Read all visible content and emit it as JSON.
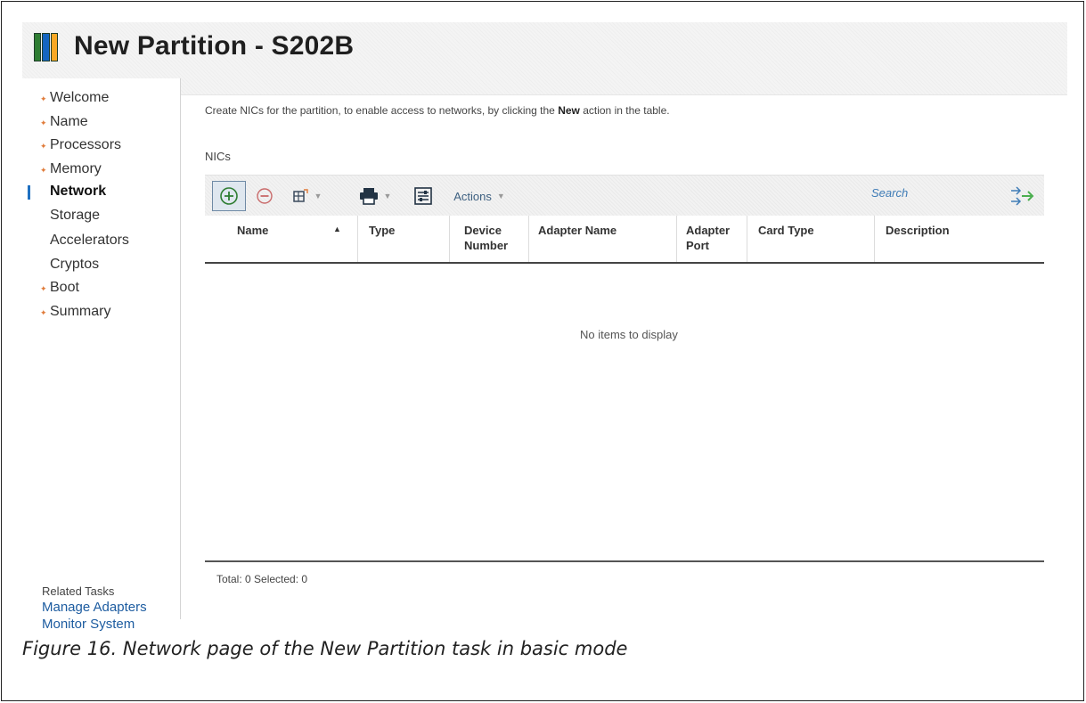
{
  "window": {
    "title": "New Partition - S202B"
  },
  "sidebar": {
    "items": [
      {
        "label": "Welcome",
        "bullet": true
      },
      {
        "label": "Name",
        "bullet": true
      },
      {
        "label": "Processors",
        "bullet": true
      },
      {
        "label": "Memory",
        "bullet": true
      },
      {
        "label": "Network",
        "bullet": false,
        "active": true
      },
      {
        "label": "Storage",
        "bullet": false
      },
      {
        "label": "Accelerators",
        "bullet": false
      },
      {
        "label": "Cryptos",
        "bullet": false
      },
      {
        "label": "Boot",
        "bullet": true
      },
      {
        "label": "Summary",
        "bullet": true
      }
    ],
    "related_tasks_title": "Related Tasks",
    "related_links": [
      "Manage Adapters",
      "Monitor System"
    ]
  },
  "main": {
    "intro_prefix": "Create NICs for the partition, to enable access to networks, by clicking the ",
    "intro_bold": "New",
    "intro_suffix": " action in the table.",
    "section_label": "NICs",
    "toolbar": {
      "actions_label": "Actions",
      "search_placeholder": "Search"
    },
    "table": {
      "columns": [
        "Name",
        "Type",
        "Device Number",
        "Adapter Name",
        "Adapter Port",
        "Card Type",
        "Description"
      ],
      "sorted_column": "Name",
      "sort_direction": "ascending",
      "empty_message": "No items to display"
    },
    "footer_status": "Total: 0 Selected: 0"
  },
  "caption": "Figure 16. Network page of the New Partition task in basic mode",
  "colors": {
    "link": "#1d5ca0",
    "bullet": "#e07b3a",
    "active_indicator": "#1f70c1",
    "add_icon": "#2e7d32",
    "remove_icon": "#c62828"
  }
}
